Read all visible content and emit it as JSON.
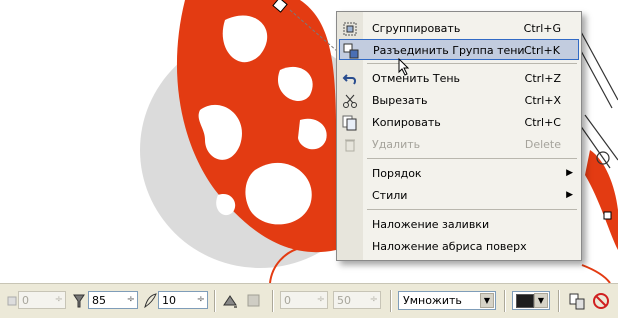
{
  "context_menu": {
    "items": [
      {
        "label": "Сгруппировать",
        "shortcut": "Ctrl+G",
        "icon": "group-icon"
      },
      {
        "label": "Разъединить Группа тени",
        "shortcut": "Ctrl+K",
        "icon": "break-apart-icon",
        "highlighted": true
      },
      {
        "label": "Отменить Тень",
        "shortcut": "Ctrl+Z",
        "icon": "undo-icon"
      },
      {
        "label": "Вырезать",
        "shortcut": "Ctrl+X",
        "icon": "scissors-icon"
      },
      {
        "label": "Копировать",
        "shortcut": "Ctrl+C",
        "icon": "copy-icon"
      },
      {
        "label": "Удалить",
        "shortcut": "Delete",
        "icon": "trash-icon",
        "disabled": true
      },
      {
        "label": "Порядок",
        "submenu_arrow": "▶"
      },
      {
        "label": "Стили",
        "submenu_arrow": "▶"
      },
      {
        "label": "Наложение заливки"
      },
      {
        "label": "Наложение абриса поверх"
      }
    ]
  },
  "toolbar": {
    "offset_x_value": "0",
    "opacity_value": "85",
    "feather_value": "10",
    "offset_a_value": "0",
    "offset_b_value": "50",
    "blend_mode": "Умножить",
    "shadow_color": "#1e1e1e",
    "spin_glyph": "÷",
    "dropdown_glyph": "▼"
  },
  "colors": {
    "shape_orange": "#e33b12",
    "highlight": "#c2ccdf",
    "highlight_border": "#316ac5"
  }
}
